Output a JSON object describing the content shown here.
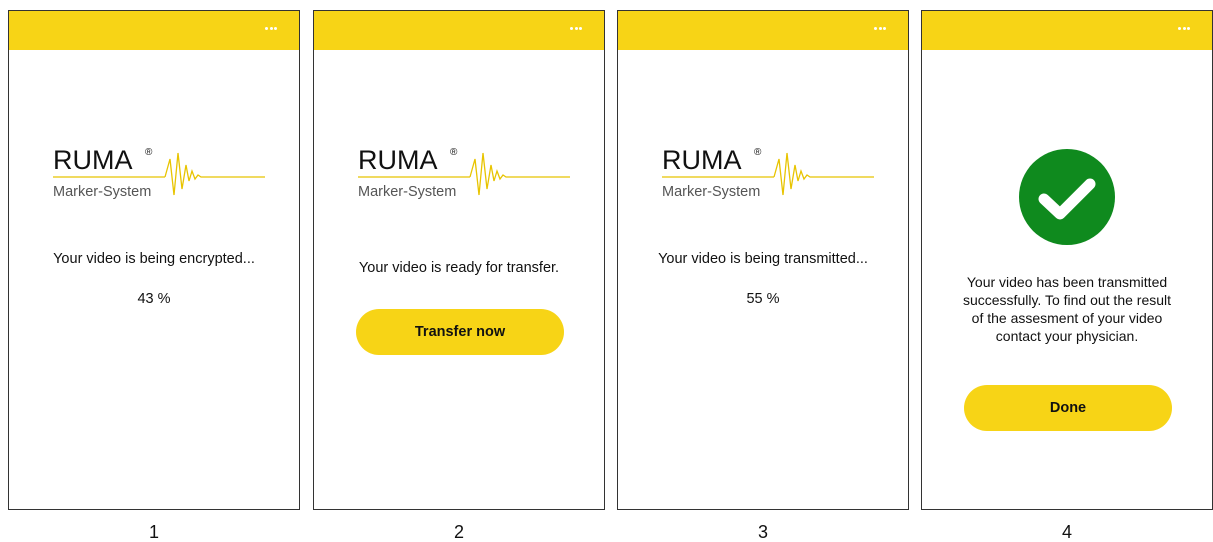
{
  "brand": {
    "name": "RUMA",
    "registered_mark": "®",
    "subtitle": "Marker-System",
    "accent_color": "#f7d416",
    "success_color": "#0f8a1e"
  },
  "screens": [
    {
      "step": "1",
      "menu_icon": "more-horizontal-icon",
      "message": "Your video is being encrypted...",
      "progress_text": "43 %",
      "progress": 0.43
    },
    {
      "step": "2",
      "menu_icon": "more-horizontal-icon",
      "message": "Your video is ready for transfer.",
      "button_label": "Transfer now"
    },
    {
      "step": "3",
      "menu_icon": "more-horizontal-icon",
      "message": "Your video is being transmitted...",
      "progress_text": "55 %",
      "progress": 0.55
    },
    {
      "step": "4",
      "menu_icon": "more-horizontal-icon",
      "status_icon": "checkmark-circle-icon",
      "message_lines": [
        "Your video has been transmitted",
        "successfully. To find out the result",
        "of the assesment of your video",
        "contact your physician."
      ],
      "button_label": "Done"
    }
  ]
}
